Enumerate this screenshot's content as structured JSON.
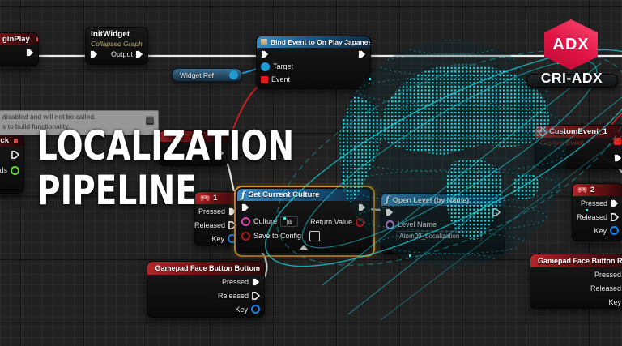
{
  "brand": {
    "logo_label": "ADX",
    "name": "CRI-ADX"
  },
  "headline": {
    "line1": "LOCALIZATION",
    "line2": "PIPELINE"
  },
  "tooltip": {
    "line1": "disabled and will not be called.",
    "line2": "s to build functionality."
  },
  "icons": {
    "fn": "ƒ"
  },
  "pin_labels": {
    "pressed": "Pressed",
    "released": "Released",
    "key": "Key",
    "output": "Output",
    "target": "Target",
    "event": "Event",
    "culture": "Culture",
    "save_to_config": "Save to Config",
    "return_value": "Return Value",
    "level_name": "Level Name"
  },
  "nodes": {
    "begin_play": {
      "title": "ginPlay"
    },
    "init_widget": {
      "title": "InitWidget",
      "subtitle": "Collapsed Graph"
    },
    "widget_ref": {
      "label": "Widget Ref"
    },
    "bind_event": {
      "title": "Bind Event to On Play Japanese"
    },
    "edge_event": {
      "title": "ck",
      "pin_label": "ds"
    },
    "key_1": {
      "title": "1"
    },
    "set_culture": {
      "title": "Set Current Culture",
      "culture_value": "ja"
    },
    "open_level": {
      "title": "Open Level (by Name)",
      "level_name_value": "Atom09_Localization"
    },
    "custom_event": {
      "title": "CustomEvent_1",
      "subtitle": "Custom Event"
    },
    "key_2": {
      "title": "2"
    },
    "gamepad_bottom": {
      "title": "Gamepad Face Button Bottom"
    },
    "gamepad_right": {
      "title": "Gamepad Face Button Right"
    }
  },
  "colors": {
    "accent_cyan": "#1ae1ec",
    "selection_orange": "#df9b26",
    "logo_red": "#e8174a",
    "wire_white": "#ececec",
    "wire_blue": "#1f9ad6",
    "wire_red": "#c42020",
    "header_red": "#a1181c",
    "header_blue": "#2a7fb8"
  }
}
